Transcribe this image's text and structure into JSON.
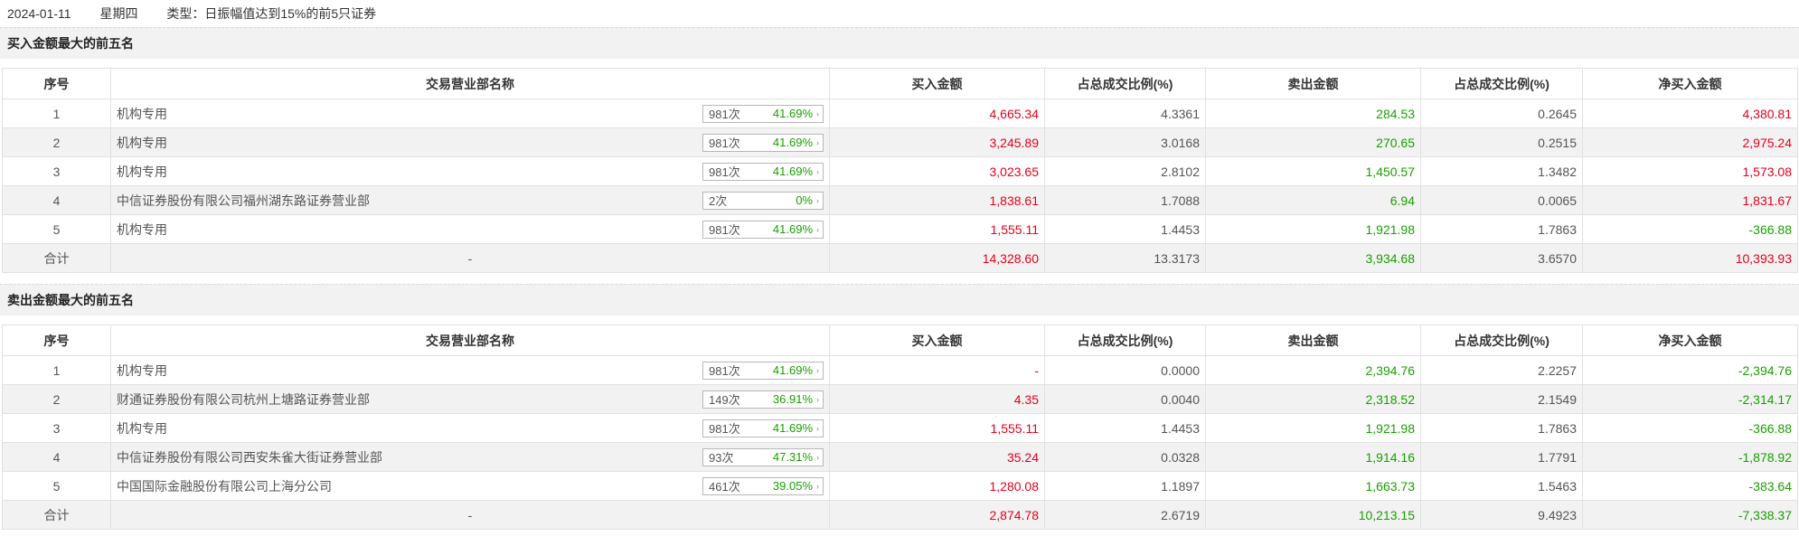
{
  "header": {
    "date": "2024-01-11",
    "weekday": "星期四",
    "type_text": "类型：日振幅值达到15%的前5只证券"
  },
  "columns": [
    "序号",
    "交易营业部名称",
    "买入金额",
    "占总成交比例(%)",
    "卖出金额",
    "占总成交比例(%)",
    "净买入金额"
  ],
  "arrow_glyph": "›",
  "buy_section": {
    "title": "买入金额最大的前五名",
    "rows": [
      {
        "idx": "1",
        "name": "机构专用",
        "count": "981次",
        "pct": "41.69%",
        "buy": "4,665.34",
        "buy_ratio": "4.3361",
        "sell": "284.53",
        "sell_ratio": "0.2645",
        "net": "4,380.81",
        "net_color": "red"
      },
      {
        "idx": "2",
        "name": "机构专用",
        "count": "981次",
        "pct": "41.69%",
        "buy": "3,245.89",
        "buy_ratio": "3.0168",
        "sell": "270.65",
        "sell_ratio": "0.2515",
        "net": "2,975.24",
        "net_color": "red"
      },
      {
        "idx": "3",
        "name": "机构专用",
        "count": "981次",
        "pct": "41.69%",
        "buy": "3,023.65",
        "buy_ratio": "2.8102",
        "sell": "1,450.57",
        "sell_ratio": "1.3482",
        "net": "1,573.08",
        "net_color": "red"
      },
      {
        "idx": "4",
        "name": "中信证券股份有限公司福州湖东路证券营业部",
        "count": "2次",
        "pct": "0%",
        "buy": "1,838.61",
        "buy_ratio": "1.7088",
        "sell": "6.94",
        "sell_ratio": "0.0065",
        "net": "1,831.67",
        "net_color": "red"
      },
      {
        "idx": "5",
        "name": "机构专用",
        "count": "981次",
        "pct": "41.69%",
        "buy": "1,555.11",
        "buy_ratio": "1.4453",
        "sell": "1,921.98",
        "sell_ratio": "1.7863",
        "net": "-366.88",
        "net_color": "green"
      }
    ],
    "total": {
      "label": "合计",
      "name": "-",
      "buy": "14,328.60",
      "buy_ratio": "13.3173",
      "sell": "3,934.68",
      "sell_ratio": "3.6570",
      "net": "10,393.93",
      "net_color": "red"
    }
  },
  "sell_section": {
    "title": "卖出金额最大的前五名",
    "rows": [
      {
        "idx": "1",
        "name": "机构专用",
        "count": "981次",
        "pct": "41.69%",
        "buy": "-",
        "buy_ratio": "0.0000",
        "sell": "2,394.76",
        "sell_ratio": "2.2257",
        "net": "-2,394.76",
        "net_color": "green"
      },
      {
        "idx": "2",
        "name": "财通证券股份有限公司杭州上塘路证券营业部",
        "count": "149次",
        "pct": "36.91%",
        "buy": "4.35",
        "buy_ratio": "0.0040",
        "sell": "2,318.52",
        "sell_ratio": "2.1549",
        "net": "-2,314.17",
        "net_color": "green"
      },
      {
        "idx": "3",
        "name": "机构专用",
        "count": "981次",
        "pct": "41.69%",
        "buy": "1,555.11",
        "buy_ratio": "1.4453",
        "sell": "1,921.98",
        "sell_ratio": "1.7863",
        "net": "-366.88",
        "net_color": "green"
      },
      {
        "idx": "4",
        "name": "中信证券股份有限公司西安朱雀大街证券营业部",
        "count": "93次",
        "pct": "47.31%",
        "buy": "35.24",
        "buy_ratio": "0.0328",
        "sell": "1,914.16",
        "sell_ratio": "1.7791",
        "net": "-1,878.92",
        "net_color": "green"
      },
      {
        "idx": "5",
        "name": "中国国际金融股份有限公司上海分公司",
        "count": "461次",
        "pct": "39.05%",
        "buy": "1,280.08",
        "buy_ratio": "1.1897",
        "sell": "1,663.73",
        "sell_ratio": "1.5463",
        "net": "-383.64",
        "net_color": "green"
      }
    ],
    "total": {
      "label": "合计",
      "name": "-",
      "buy": "2,874.78",
      "buy_ratio": "2.6719",
      "sell": "10,213.15",
      "sell_ratio": "9.4923",
      "net": "-7,338.37",
      "net_color": "green"
    }
  },
  "colors": {
    "buy_red": "#e4001b",
    "sell_green": "#189f00",
    "stripe": "#f2f2f2",
    "border": "#e1e1e1"
  }
}
